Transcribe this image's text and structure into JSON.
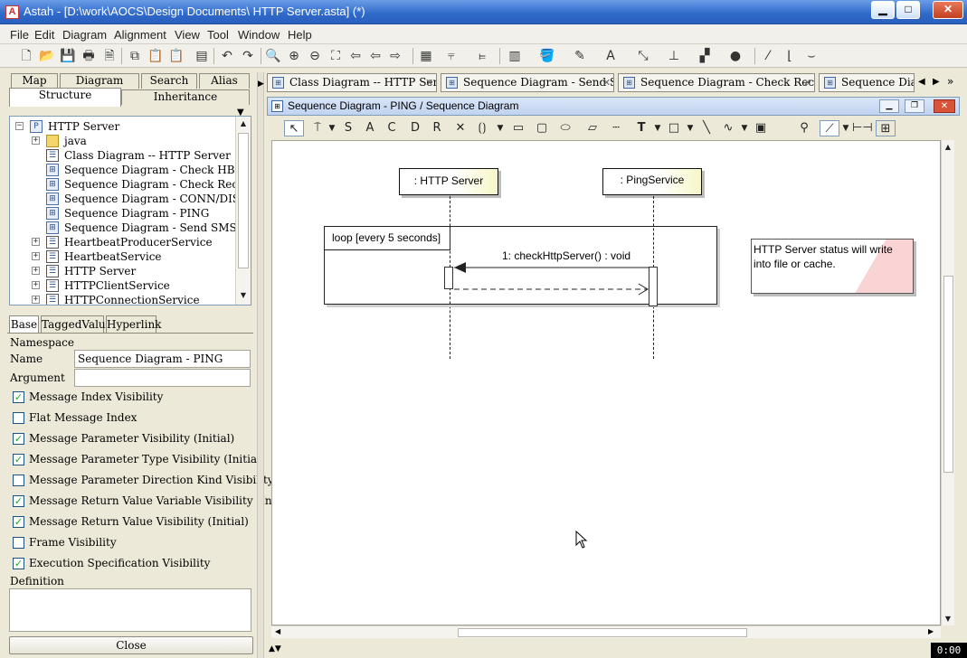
{
  "window": {
    "title": "Astah - [D:\\work\\AOCS\\Design Documents\\ HTTP Server.asta] (*)",
    "app_icon": "astah-logo-icon",
    "controls": [
      "minimize-icon",
      "maximize-icon",
      "close-icon"
    ]
  },
  "menu": [
    {
      "label": "File"
    },
    {
      "label": "Edit"
    },
    {
      "label": "Diagram"
    },
    {
      "label": "Alignment"
    },
    {
      "label": "View"
    },
    {
      "label": "Tool"
    },
    {
      "label": "Window"
    },
    {
      "label": "Help"
    }
  ],
  "toolbar_icons": [
    "new-icon",
    "open-icon",
    "save-icon",
    "print-icon",
    "print-preview-icon",
    "copy-icon",
    "paste-icon",
    "paste-alt-icon",
    "undo-icon",
    "redo-icon",
    "zoom-icon",
    "zoom-in-icon",
    "zoom-out-icon",
    "fit-icon",
    "back-icon",
    "forward-icon",
    "layout-icon",
    "align-icon",
    "align-left-icon",
    "stack-icon",
    "fill-color-icon",
    "line-color-icon",
    "font-color-icon",
    "line-style-icon",
    "tree-layout-icon",
    "arrange-icon",
    "shape-icon",
    "no-style-icon",
    "line-icon",
    "curve-icon"
  ],
  "left_tabs": {
    "row1": [
      "Map",
      "Diagram",
      "Search",
      "Alias"
    ],
    "row2": [
      "Structure",
      "Inheritance"
    ]
  },
  "tree": [
    {
      "label": "HTTP Server",
      "type": "package",
      "indent": 0,
      "toggle": "−"
    },
    {
      "label": "java",
      "type": "folder",
      "indent": 1,
      "toggle": "+"
    },
    {
      "label": "Class Diagram -- HTTP Server",
      "type": "class",
      "indent": 1,
      "toggle": ""
    },
    {
      "label": "Sequence Diagram - Check HB",
      "type": "sequence",
      "indent": 1,
      "toggle": ""
    },
    {
      "label": "Sequence Diagram - Check Receiver",
      "type": "sequence",
      "indent": 1,
      "toggle": ""
    },
    {
      "label": "Sequence Diagram - CONN/DISCONN",
      "type": "sequence",
      "indent": 1,
      "toggle": ""
    },
    {
      "label": "Sequence Diagram - PING",
      "type": "sequence",
      "indent": 1,
      "toggle": ""
    },
    {
      "label": "Sequence Diagram - Send SMS",
      "type": "sequence",
      "indent": 1,
      "toggle": ""
    },
    {
      "label": "HeartbeatProducerService",
      "type": "class",
      "indent": 1,
      "toggle": "+"
    },
    {
      "label": "HeartbeatService",
      "type": "class",
      "indent": 1,
      "toggle": "+"
    },
    {
      "label": "HTTP Server",
      "type": "class",
      "indent": 1,
      "toggle": "+"
    },
    {
      "label": "HTTPClientService",
      "type": "class",
      "indent": 1,
      "toggle": "+"
    },
    {
      "label": "HTTPConnectionService",
      "type": "class",
      "indent": 1,
      "toggle": "+"
    }
  ],
  "prop_tabs": [
    "Base",
    "TaggedValue",
    "Hyperlink"
  ],
  "props": {
    "namespace_label": "Namespace",
    "name_label": "Name",
    "name_value": "Sequence Diagram - PING",
    "argument_label": "Argument",
    "argument_value": "",
    "definition_label": "Definition"
  },
  "checkboxes": [
    {
      "label": "Message Index Visibility",
      "checked": true
    },
    {
      "label": "Flat Message Index",
      "checked": false
    },
    {
      "label": "Message Parameter Visibility (Initial)",
      "checked": true
    },
    {
      "label": "Message Parameter Type Visibility (Initial)",
      "checked": true
    },
    {
      "label": "Message Parameter Direction Kind Visibility (Initi...",
      "checked": false
    },
    {
      "label": "Message Return Value Variable Visibility (Initial)",
      "checked": true
    },
    {
      "label": "Message Return Value Visibility (Initial)",
      "checked": true
    },
    {
      "label": "Frame Visibility",
      "checked": false
    },
    {
      "label": "Execution Specification Visibility",
      "checked": true
    }
  ],
  "close_button": "Close",
  "doc_tabs": [
    {
      "label": "Class Diagram -- HTTP Server"
    },
    {
      "label": "Sequence Diagram - Send SMS"
    },
    {
      "label": "Sequence Diagram - Check Receiver"
    },
    {
      "label": "Sequence Diagra"
    }
  ],
  "inner_window_title": "Sequence Diagram - PING / Sequence Diagram",
  "diagram": {
    "lifelines": [
      {
        "label": ": HTTP Server"
      },
      {
        "label": ": PingService"
      }
    ],
    "frame_label": "loop  [every 5 seconds]",
    "message": "1: checkHttpServer() : void",
    "note": "HTTP Server status will write into file or cache."
  },
  "clock": "0:00",
  "colors": {
    "titlebar": "#2F69C9",
    "panel": "#ECE9D8",
    "note_accent": "#FAD4D4",
    "lifeline_accent": "#F7F6C8"
  }
}
